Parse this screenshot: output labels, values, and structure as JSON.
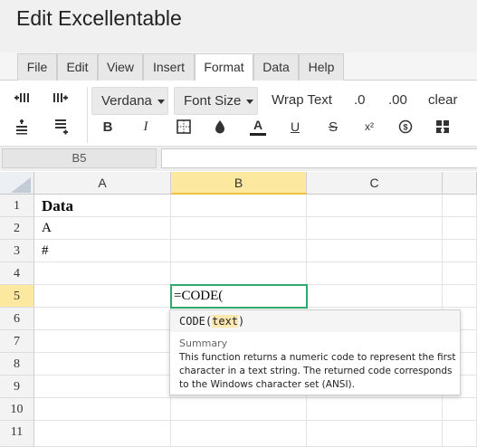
{
  "app": {
    "title": "Edit Excellentable"
  },
  "tabs": [
    {
      "label": "File",
      "active": false
    },
    {
      "label": "Edit",
      "active": false
    },
    {
      "label": "View",
      "active": false
    },
    {
      "label": "Insert",
      "active": false
    },
    {
      "label": "Format",
      "active": true
    },
    {
      "label": "Data",
      "active": false
    },
    {
      "label": "Help",
      "active": false
    }
  ],
  "toolbar": {
    "font_family": "Verdana",
    "font_size": "Font Size",
    "wrap_text": "Wrap Text",
    "decrease_decimal": ".0",
    "increase_decimal": ".00",
    "clear": "clear",
    "bold": "B",
    "italic": "I",
    "font_color": "A",
    "underline": "U",
    "strikethrough": "S",
    "superscript": "x²"
  },
  "name_box": {
    "value": "B5"
  },
  "formula_bar": {
    "value": ""
  },
  "columns": [
    "A",
    "B",
    "C"
  ],
  "active_column": "B",
  "rows": [
    "1",
    "2",
    "3",
    "4",
    "5",
    "6",
    "7",
    "8",
    "9",
    "10",
    "11"
  ],
  "active_row": "5",
  "cells": {
    "A1": "Data",
    "A2": "A",
    "A3": "#",
    "B5": "=CODE("
  },
  "tooltip": {
    "function_name": "CODE(",
    "param": "text",
    "close_paren": ")",
    "summary_label": "Summary",
    "description": "This function returns a numeric code to represent the first character in a text string. The returned code corresponds to the Windows character set (ANSI)."
  },
  "colors": {
    "active_header": "#fde8a0",
    "edit_border": "#2eaa6e",
    "param_highlight": "#fbe8b0"
  }
}
